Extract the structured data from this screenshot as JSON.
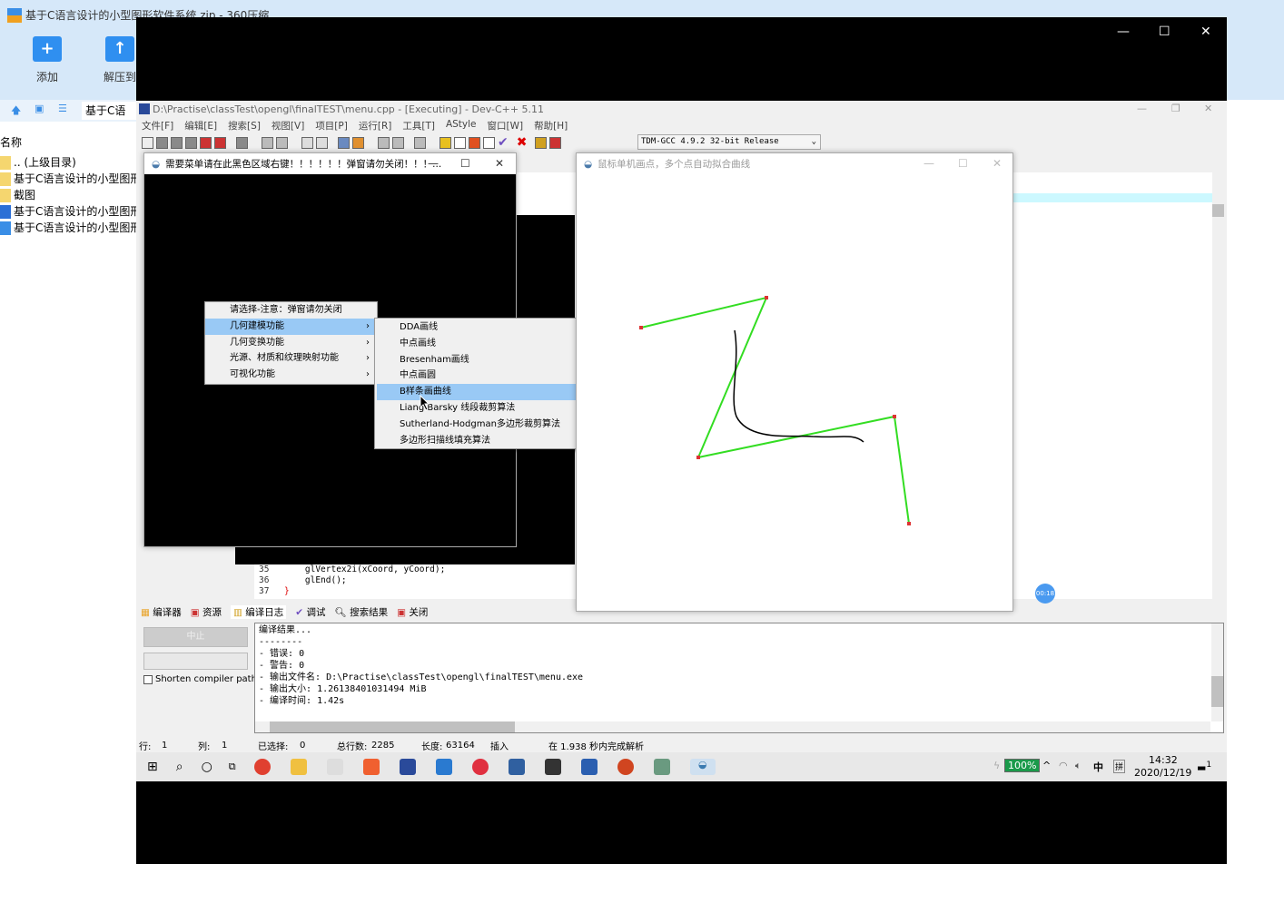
{
  "zip": {
    "title": "基于C语言设计的小型图形软件系统.zip - 360压缩",
    "add": "添加",
    "extract": "解压到",
    "path": "基于C语",
    "column": "名称",
    "files": [
      ".. (上级目录)",
      "基于C语言设计的小型图形软件系统",
      "截图",
      "基于C语言设计的小型图形软件系统.docx",
      "基于C语言设计的小型图形软件系统.exe"
    ]
  },
  "devcpp": {
    "title": "D:\\Practise\\classTest\\opengl\\finalTEST\\menu.cpp - [Executing] - Dev-C++ 5.11",
    "menu": [
      "文件[F]",
      "编辑[E]",
      "搜索[S]",
      "视图[V]",
      "项目[P]",
      "运行[R]",
      "工具[T]",
      "AStyle",
      "窗口[W]",
      "帮助[H]"
    ],
    "compiler": "TDM-GCC 4.9.2 32-bit Release",
    "code": [
      {
        "n": "35",
        "t": "    glVertex2i(xCoord, yCoord);"
      },
      {
        "n": "36",
        "t": "    glEnd();"
      },
      {
        "n": "37",
        "t": "}"
      }
    ],
    "tabs": [
      "编译器",
      "资源",
      "编译日志",
      "调试",
      "搜索结果",
      "关闭"
    ],
    "stop": "中止",
    "shorten": "Shorten compiler paths",
    "log": [
      "编译结果...",
      "--------",
      "- 错误: 0",
      "- 警告: 0",
      "- 输出文件名: D:\\Practise\\classTest\\opengl\\finalTEST\\menu.exe",
      "- 输出大小: 1.26138401031494 MiB",
      "- 编译时间: 1.42s"
    ],
    "status": {
      "row_label": "行:",
      "row": "1",
      "col_label": "列:",
      "col": "1",
      "sel_label": "已选择:",
      "sel": "0",
      "total_label": "总行数:",
      "total": "2285",
      "len_label": "长度:",
      "len": "63164",
      "mode": "插入",
      "parse": "在 1.938 秒内完成解析"
    }
  },
  "glwin1": {
    "title": "需要菜单请在此黑色区域右键！！！！！！弹窗请勿关闭！！！..."
  },
  "glwin2": {
    "title": "鼠标单机画点，多个点自动拟合曲线"
  },
  "context_menu": {
    "items": [
      "请选择-注意：弹窗请勿关闭",
      "几何建模功能",
      "几何变换功能",
      "光源、材质和纹理映射功能",
      "可视化功能"
    ],
    "submenu": [
      "DDA画线",
      "中点画线",
      "Bresenham画线",
      "中点画圆",
      "B样条画曲线",
      "Liang-Barsky 线段裁剪算法",
      "Sutherland-Hodgman多边形裁剪算法",
      "多边形扫描线填充算法"
    ]
  },
  "recording": "00:18",
  "tray": {
    "battery": "100%",
    "ime": "中",
    "ime2": "拼",
    "time": "14:32",
    "date": "2020/12/19",
    "notif": "1"
  },
  "colors": {
    "polyline": "#33dd22",
    "curve": "#000000",
    "menu_highlight": "#99c9f5"
  }
}
